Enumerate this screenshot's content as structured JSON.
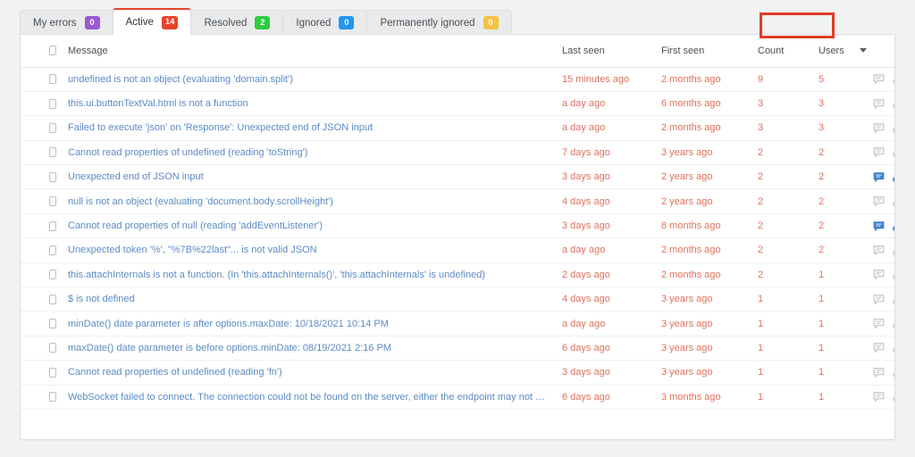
{
  "tabs": [
    {
      "label": "My errors",
      "count": "0",
      "color": "#9b59d0",
      "active": false
    },
    {
      "label": "Active",
      "count": "14",
      "color": "#e8432b",
      "active": true
    },
    {
      "label": "Resolved",
      "count": "2",
      "color": "#2ecc40",
      "active": false
    },
    {
      "label": "Ignored",
      "count": "0",
      "color": "#2196f3",
      "active": false
    },
    {
      "label": "Permanently ignored",
      "count": "0",
      "color": "#f5c242",
      "active": false
    }
  ],
  "table": {
    "columns": {
      "message": "Message",
      "last_seen": "Last seen",
      "first_seen": "First seen",
      "count": "Count",
      "users": "Users"
    },
    "sort": {
      "column": "Users",
      "direction": "desc",
      "indicator": "chevron-down-icon",
      "highlight_color": "#e23b26"
    },
    "rows": [
      {
        "message": "undefined is not an object (evaluating 'domain.split')",
        "last_seen": "15 minutes ago",
        "first_seen": "2 months ago",
        "count": "9",
        "users": "5",
        "comment_active": false,
        "link_active": false
      },
      {
        "message": "this.ui.buttonTextVal.html is not a function",
        "last_seen": "a day ago",
        "first_seen": "6 months ago",
        "count": "3",
        "users": "3",
        "comment_active": false,
        "link_active": false
      },
      {
        "message": "Failed to execute 'json' on 'Response': Unexpected end of JSON input",
        "last_seen": "a day ago",
        "first_seen": "2 months ago",
        "count": "3",
        "users": "3",
        "comment_active": false,
        "link_active": false
      },
      {
        "message": "Cannot read properties of undefined (reading 'toString')",
        "last_seen": "7 days ago",
        "first_seen": "3 years ago",
        "count": "2",
        "users": "2",
        "comment_active": false,
        "link_active": false
      },
      {
        "message": "Unexpected end of JSON input",
        "last_seen": "3 days ago",
        "first_seen": "2 years ago",
        "count": "2",
        "users": "2",
        "comment_active": true,
        "link_active": true
      },
      {
        "message": "null is not an object (evaluating 'document.body.scrollHeight')",
        "last_seen": "4 days ago",
        "first_seen": "2 years ago",
        "count": "2",
        "users": "2",
        "comment_active": false,
        "link_active": false
      },
      {
        "message": "Cannot read properties of null (reading 'addEventListener')",
        "last_seen": "3 days ago",
        "first_seen": "8 months ago",
        "count": "2",
        "users": "2",
        "comment_active": true,
        "link_active": true
      },
      {
        "message": "Unexpected token '%', \"%7B%22last\"... is not valid JSON",
        "last_seen": "a day ago",
        "first_seen": "2 months ago",
        "count": "2",
        "users": "2",
        "comment_active": false,
        "link_active": false
      },
      {
        "message": "this.attachInternals is not a function. (In 'this.attachInternals()', 'this.attachInternals' is undefined)",
        "last_seen": "2 days ago",
        "first_seen": "2 months ago",
        "count": "2",
        "users": "1",
        "comment_active": false,
        "link_active": false
      },
      {
        "message": "$ is not defined",
        "last_seen": "4 days ago",
        "first_seen": "3 years ago",
        "count": "1",
        "users": "1",
        "comment_active": false,
        "link_active": false
      },
      {
        "message": "minDate() date parameter is after options.maxDate: 10/18/2021 10:14 PM",
        "last_seen": "a day ago",
        "first_seen": "3 years ago",
        "count": "1",
        "users": "1",
        "comment_active": false,
        "link_active": false
      },
      {
        "message": "maxDate() date parameter is before options.minDate: 08/19/2021 2:16 PM",
        "last_seen": "6 days ago",
        "first_seen": "3 years ago",
        "count": "1",
        "users": "1",
        "comment_active": false,
        "link_active": false
      },
      {
        "message": "Cannot read properties of undefined (reading 'fn')",
        "last_seen": "3 days ago",
        "first_seen": "3 years ago",
        "count": "1",
        "users": "1",
        "comment_active": false,
        "link_active": false
      },
      {
        "message": "WebSocket failed to connect. The connection could not be found on the server, either the endpoint may not be a ...",
        "last_seen": "6 days ago",
        "first_seen": "3 months ago",
        "count": "1",
        "users": "1",
        "comment_active": false,
        "link_active": false
      }
    ]
  }
}
